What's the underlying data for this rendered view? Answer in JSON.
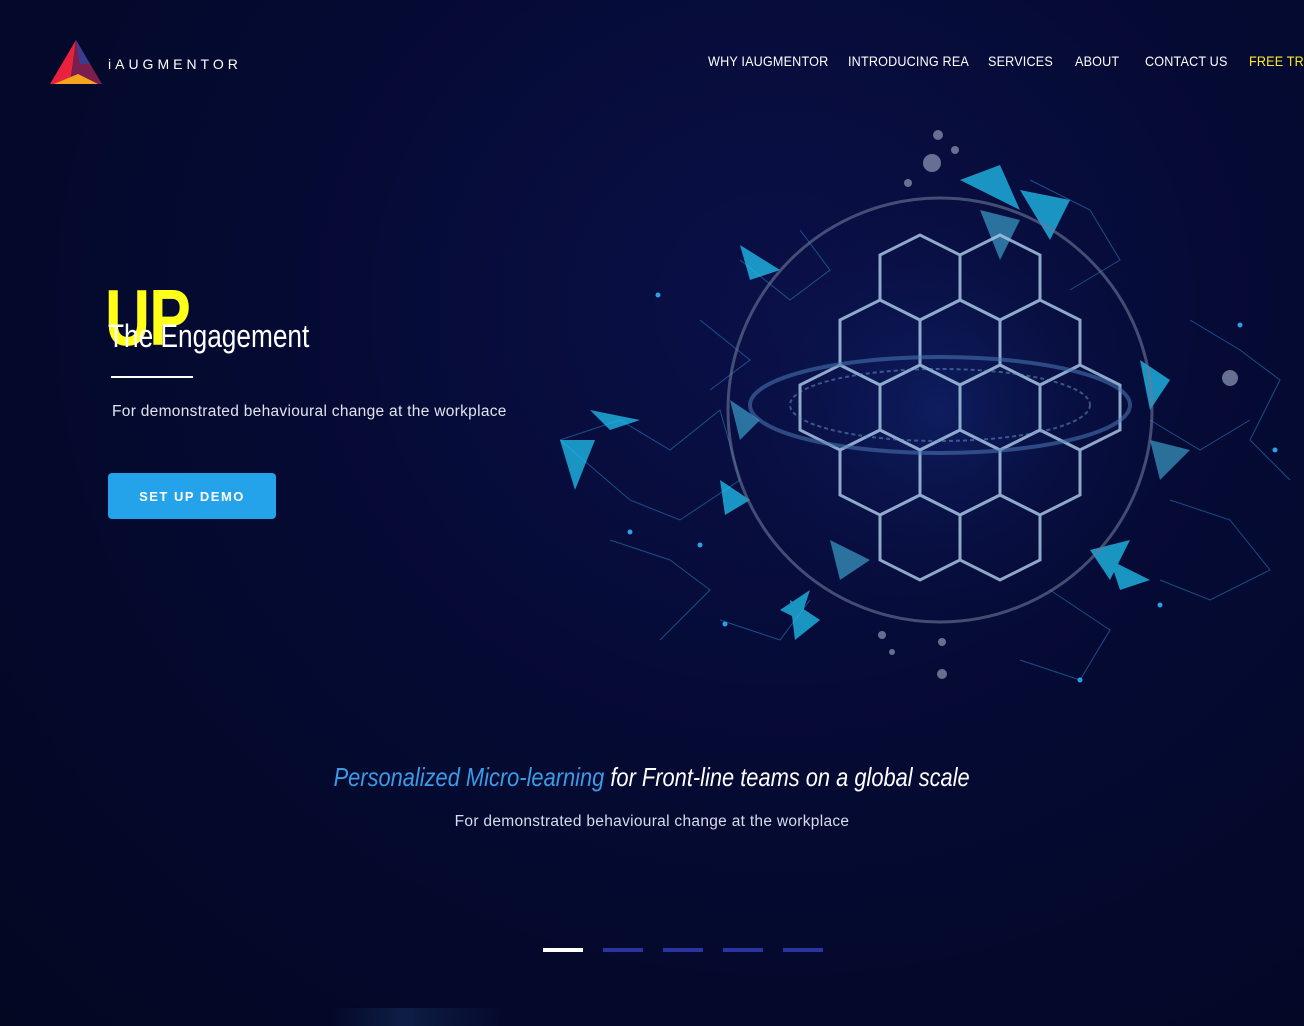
{
  "brand": {
    "name": "iAUGMENTOR",
    "logo_icon": "triangle-logo-icon"
  },
  "nav": {
    "items": [
      {
        "label": "WHY IAUGMENTOR"
      },
      {
        "label": "INTRODUCING REA"
      },
      {
        "label": "SERVICES"
      },
      {
        "label": "ABOUT"
      },
      {
        "label": "CONTACT US"
      },
      {
        "label": "FREE TRIA"
      }
    ]
  },
  "hero": {
    "big_word": "UP",
    "subtitle": "The Engagement",
    "description": "For demonstrated behavioural change at the workplace",
    "cta_label": "SET UP DEMO"
  },
  "section": {
    "tagline_accent": "Personalized Micro-learning",
    "tagline_rest": "for Front-line teams on a global scale",
    "description": "For demonstrated behavioural change at the workplace"
  },
  "slider": {
    "slide_count": 5,
    "active_index": 0
  },
  "colors": {
    "background": "#050a33",
    "accent_yellow": "#ffff1a",
    "accent_blue": "#24a3ea",
    "tagline_blue": "#3a9be8",
    "trial_yellow": "#ffe82e"
  }
}
